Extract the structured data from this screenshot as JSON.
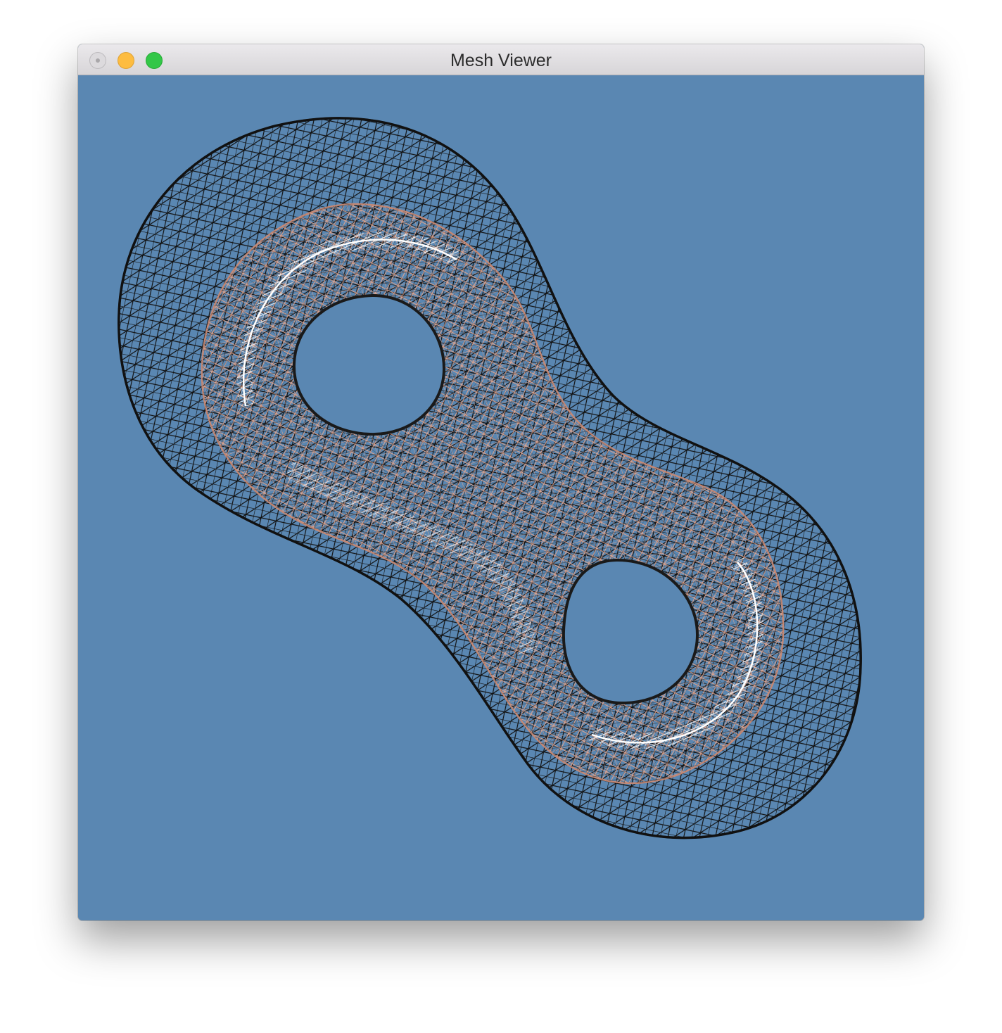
{
  "window": {
    "title": "Mesh Viewer"
  },
  "titlebar": {
    "buttons": [
      {
        "name": "close",
        "color": "#dcdadd"
      },
      {
        "name": "minimize",
        "color": "#fdbc40"
      },
      {
        "name": "zoom",
        "color": "#33c748"
      }
    ]
  },
  "viewport": {
    "background_color": "#5a87b2",
    "mesh": {
      "type": "double torus",
      "render_mode": "wireframe",
      "outer_surface_color": "#111111",
      "inner_surface_color": "#e8a58a",
      "highlight_color": "#ffffff"
    }
  }
}
